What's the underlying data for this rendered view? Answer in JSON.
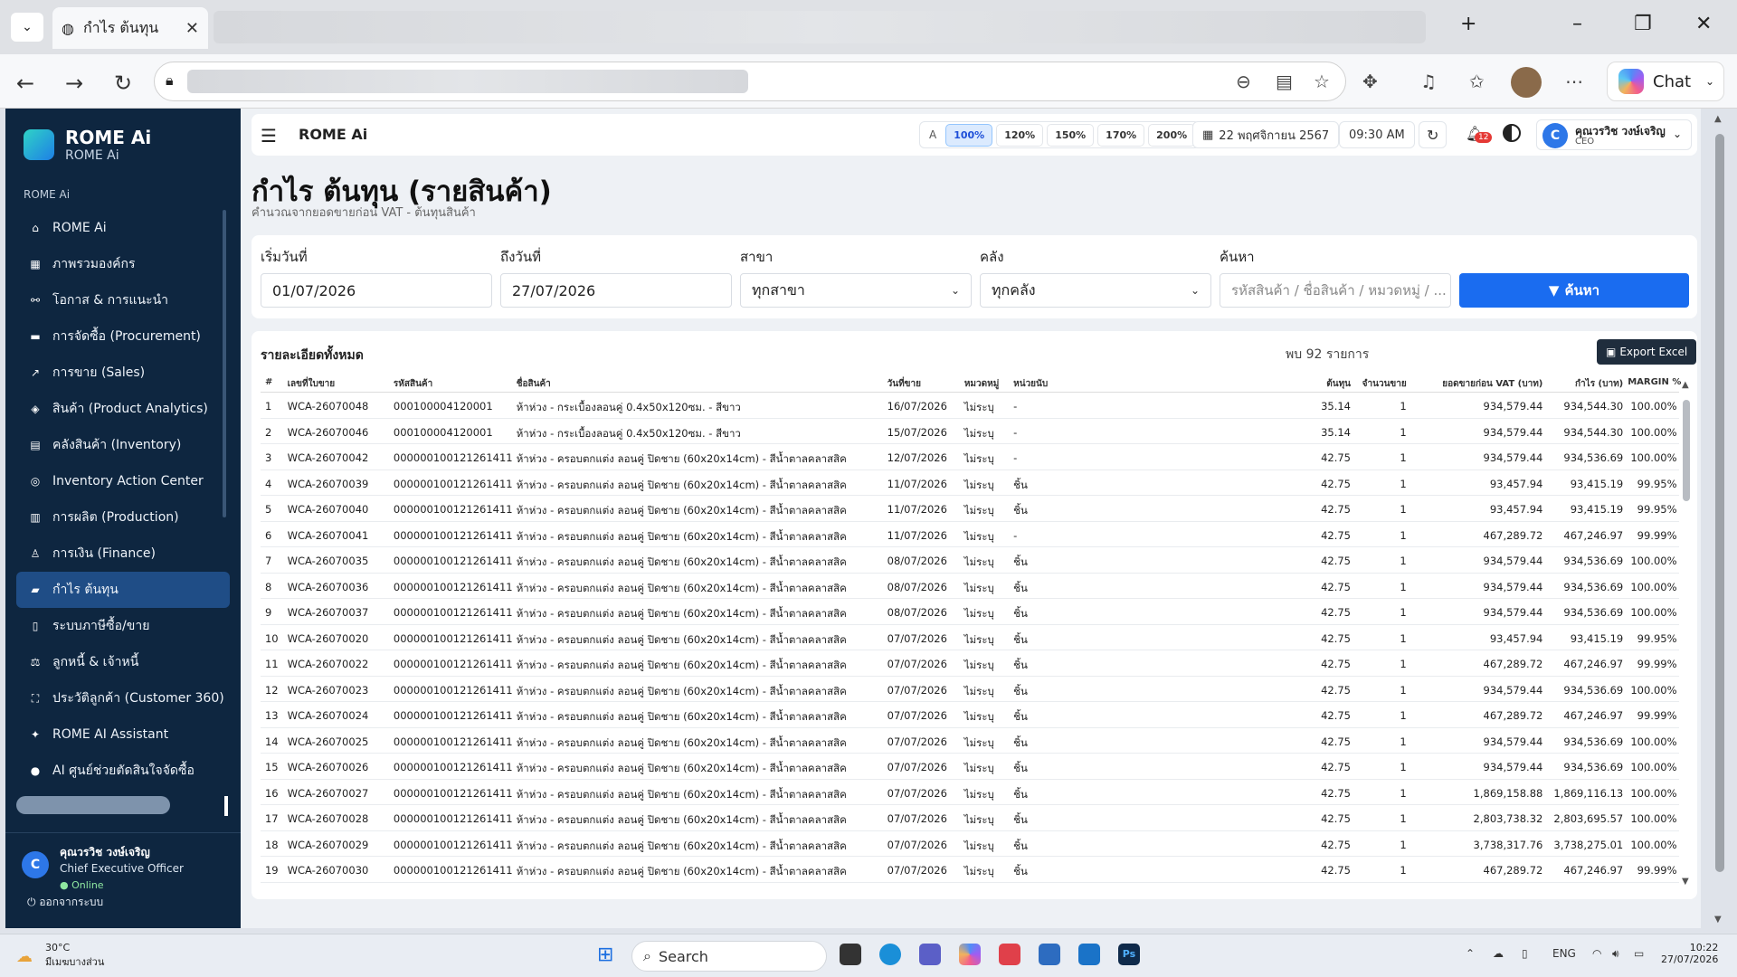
{
  "browser": {
    "tab_title": "กำไร ต้นทุน",
    "chat_label": "Chat"
  },
  "app": {
    "brand": "ROME Ai",
    "brand_sub": "ROME Ai",
    "section": "ROME Ai",
    "topbar_title": "ROME Ai"
  },
  "menu": [
    {
      "icon": "home-icon",
      "glyph": "⌂",
      "label": "ROME Ai"
    },
    {
      "icon": "building-icon",
      "glyph": "▦",
      "label": "ภาพรวมองค์กร"
    },
    {
      "icon": "link-icon",
      "glyph": "⚯",
      "label": "โอกาส & การแนะนำ"
    },
    {
      "icon": "cart-icon",
      "glyph": "▬",
      "label": "การจัดซื้อ (Procurement)"
    },
    {
      "icon": "chart-line-icon",
      "glyph": "↗",
      "label": "การขาย (Sales)"
    },
    {
      "icon": "boxes-icon",
      "glyph": "◈",
      "label": "สินค้า (Product Analytics)"
    },
    {
      "icon": "warehouse-icon",
      "glyph": "▤",
      "label": "คลังสินค้า (Inventory)"
    },
    {
      "icon": "target-icon",
      "glyph": "◎",
      "label": "Inventory Action Center"
    },
    {
      "icon": "factory-icon",
      "glyph": "▥",
      "label": "การผลิต (Production)"
    },
    {
      "icon": "money-icon",
      "glyph": "♙",
      "label": "การเงิน (Finance)"
    },
    {
      "icon": "profit-icon",
      "glyph": "▰",
      "label": "กำไร ต้นทุน",
      "active": true
    },
    {
      "icon": "receipt-icon",
      "glyph": "▯",
      "label": "ระบบภาษีซื้อ/ขาย"
    },
    {
      "icon": "scale-icon",
      "glyph": "⚖",
      "label": "ลูกหนี้ & เจ้าหนี้"
    },
    {
      "icon": "customer-icon",
      "glyph": "⛶",
      "label": "ประวัติลูกค้า (Customer 360)"
    },
    {
      "icon": "robot-icon",
      "glyph": "✦",
      "label": "ROME AI Assistant"
    },
    {
      "icon": "brain-icon",
      "glyph": "●",
      "label": "AI ศูนย์ช่วยตัดสินใจจัดซื้อ"
    }
  ],
  "user": {
    "initial": "C",
    "name": "คุณวรวิช วงษ์เจริญ",
    "role": "Chief Executive Officer",
    "status": "● Online",
    "logout": "ออกจากระบบ",
    "short_role": "CEO"
  },
  "zoom": {
    "a_label": "A",
    "levels": [
      "100%",
      "120%",
      "150%",
      "170%",
      "200%"
    ],
    "active": "100%"
  },
  "date_label": "22 พฤศจิกายน 2567",
  "time_label": "09:30 AM",
  "notif_count": "12",
  "page": {
    "title": "กำไร ต้นทุน (รายสินค้า)",
    "subtitle": "คำนวณจากยอดขายก่อน VAT - ต้นทุนสินค้า"
  },
  "filters": {
    "start_label": "เริ่มวันที่",
    "start_value": "01/07/2026",
    "end_label": "ถึงวันที่",
    "end_value": "27/07/2026",
    "branch_label": "สาขา",
    "branch_value": "ทุกสาขา",
    "wh_label": "คลัง",
    "wh_value": "ทุกคลัง",
    "search_label": "ค้นหา",
    "search_placeholder": "รหัสสินค้า / ชื่อสินค้า / หมวดหมู่ / ...",
    "search_button": "ค้นหา"
  },
  "table": {
    "title": "รายละเอียดทั้งหมด",
    "count": "พบ 92 รายการ",
    "export": "Export Excel",
    "headers": [
      "#",
      "เลขที่ใบขาย",
      "รหัสสินค้า",
      "ชื่อสินค้า",
      "วันที่ขาย",
      "หมวดหมู่",
      "หน่วยนับ",
      "ต้นทุน",
      "จำนวนขาย",
      "ยอดขายก่อน VAT (บาท)",
      "กำไร (บาท)",
      "MARGIN %"
    ],
    "rows": [
      [
        "1",
        "WCA-26070048",
        "000100004120001",
        "ห้าห่วง - กระเบื้องลอนคู่ 0.4x50x120ซม. - สีขาว",
        "16/07/2026",
        "ไม่ระบุ",
        "-",
        "35.14",
        "1",
        "934,579.44",
        "934,544.30",
        "100.00%"
      ],
      [
        "2",
        "WCA-26070046",
        "000100004120001",
        "ห้าห่วง - กระเบื้องลอนคู่ 0.4x50x120ซม. - สีขาว",
        "15/07/2026",
        "ไม่ระบุ",
        "-",
        "35.14",
        "1",
        "934,579.44",
        "934,544.30",
        "100.00%"
      ],
      [
        "3",
        "WCA-26070042",
        "000000100121261411",
        "ห้าห่วง - ครอบตกแต่ง ลอนคู่ ปิดชาย (60x20x14cm) - สีน้ำตาลคลาสสิค",
        "12/07/2026",
        "ไม่ระบุ",
        "-",
        "42.75",
        "1",
        "934,579.44",
        "934,536.69",
        "100.00%"
      ],
      [
        "4",
        "WCA-26070039",
        "000000100121261411",
        "ห้าห่วง - ครอบตกแต่ง ลอนคู่ ปิดชาย (60x20x14cm) - สีน้ำตาลคลาสสิค",
        "11/07/2026",
        "ไม่ระบุ",
        "ชิ้น",
        "42.75",
        "1",
        "93,457.94",
        "93,415.19",
        "99.95%"
      ],
      [
        "5",
        "WCA-26070040",
        "000000100121261411",
        "ห้าห่วง - ครอบตกแต่ง ลอนคู่ ปิดชาย (60x20x14cm) - สีน้ำตาลคลาสสิค",
        "11/07/2026",
        "ไม่ระบุ",
        "ชิ้น",
        "42.75",
        "1",
        "93,457.94",
        "93,415.19",
        "99.95%"
      ],
      [
        "6",
        "WCA-26070041",
        "000000100121261411",
        "ห้าห่วง - ครอบตกแต่ง ลอนคู่ ปิดชาย (60x20x14cm) - สีน้ำตาลคลาสสิค",
        "11/07/2026",
        "ไม่ระบุ",
        "-",
        "42.75",
        "1",
        "467,289.72",
        "467,246.97",
        "99.99%"
      ],
      [
        "7",
        "WCA-26070035",
        "000000100121261411",
        "ห้าห่วง - ครอบตกแต่ง ลอนคู่ ปิดชาย (60x20x14cm) - สีน้ำตาลคลาสสิค",
        "08/07/2026",
        "ไม่ระบุ",
        "ชิ้น",
        "42.75",
        "1",
        "934,579.44",
        "934,536.69",
        "100.00%"
      ],
      [
        "8",
        "WCA-26070036",
        "000000100121261411",
        "ห้าห่วง - ครอบตกแต่ง ลอนคู่ ปิดชาย (60x20x14cm) - สีน้ำตาลคลาสสิค",
        "08/07/2026",
        "ไม่ระบุ",
        "ชิ้น",
        "42.75",
        "1",
        "934,579.44",
        "934,536.69",
        "100.00%"
      ],
      [
        "9",
        "WCA-26070037",
        "000000100121261411",
        "ห้าห่วง - ครอบตกแต่ง ลอนคู่ ปิดชาย (60x20x14cm) - สีน้ำตาลคลาสสิค",
        "08/07/2026",
        "ไม่ระบุ",
        "ชิ้น",
        "42.75",
        "1",
        "934,579.44",
        "934,536.69",
        "100.00%"
      ],
      [
        "10",
        "WCA-26070020",
        "000000100121261411",
        "ห้าห่วง - ครอบตกแต่ง ลอนคู่ ปิดชาย (60x20x14cm) - สีน้ำตาลคลาสสิค",
        "07/07/2026",
        "ไม่ระบุ",
        "ชิ้น",
        "42.75",
        "1",
        "93,457.94",
        "93,415.19",
        "99.95%"
      ],
      [
        "11",
        "WCA-26070022",
        "000000100121261411",
        "ห้าห่วง - ครอบตกแต่ง ลอนคู่ ปิดชาย (60x20x14cm) - สีน้ำตาลคลาสสิค",
        "07/07/2026",
        "ไม่ระบุ",
        "ชิ้น",
        "42.75",
        "1",
        "467,289.72",
        "467,246.97",
        "99.99%"
      ],
      [
        "12",
        "WCA-26070023",
        "000000100121261411",
        "ห้าห่วง - ครอบตกแต่ง ลอนคู่ ปิดชาย (60x20x14cm) - สีน้ำตาลคลาสสิค",
        "07/07/2026",
        "ไม่ระบุ",
        "ชิ้น",
        "42.75",
        "1",
        "934,579.44",
        "934,536.69",
        "100.00%"
      ],
      [
        "13",
        "WCA-26070024",
        "000000100121261411",
        "ห้าห่วง - ครอบตกแต่ง ลอนคู่ ปิดชาย (60x20x14cm) - สีน้ำตาลคลาสสิค",
        "07/07/2026",
        "ไม่ระบุ",
        "ชิ้น",
        "42.75",
        "1",
        "467,289.72",
        "467,246.97",
        "99.99%"
      ],
      [
        "14",
        "WCA-26070025",
        "000000100121261411",
        "ห้าห่วง - ครอบตกแต่ง ลอนคู่ ปิดชาย (60x20x14cm) - สีน้ำตาลคลาสสิค",
        "07/07/2026",
        "ไม่ระบุ",
        "ชิ้น",
        "42.75",
        "1",
        "934,579.44",
        "934,536.69",
        "100.00%"
      ],
      [
        "15",
        "WCA-26070026",
        "000000100121261411",
        "ห้าห่วง - ครอบตกแต่ง ลอนคู่ ปิดชาย (60x20x14cm) - สีน้ำตาลคลาสสิค",
        "07/07/2026",
        "ไม่ระบุ",
        "ชิ้น",
        "42.75",
        "1",
        "934,579.44",
        "934,536.69",
        "100.00%"
      ],
      [
        "16",
        "WCA-26070027",
        "000000100121261411",
        "ห้าห่วง - ครอบตกแต่ง ลอนคู่ ปิดชาย (60x20x14cm) - สีน้ำตาลคลาสสิค",
        "07/07/2026",
        "ไม่ระบุ",
        "ชิ้น",
        "42.75",
        "1",
        "1,869,158.88",
        "1,869,116.13",
        "100.00%"
      ],
      [
        "17",
        "WCA-26070028",
        "000000100121261411",
        "ห้าห่วง - ครอบตกแต่ง ลอนคู่ ปิดชาย (60x20x14cm) - สีน้ำตาลคลาสสิค",
        "07/07/2026",
        "ไม่ระบุ",
        "ชิ้น",
        "42.75",
        "1",
        "2,803,738.32",
        "2,803,695.57",
        "100.00%"
      ],
      [
        "18",
        "WCA-26070029",
        "000000100121261411",
        "ห้าห่วง - ครอบตกแต่ง ลอนคู่ ปิดชาย (60x20x14cm) - สีน้ำตาลคลาสสิค",
        "07/07/2026",
        "ไม่ระบุ",
        "ชิ้น",
        "42.75",
        "1",
        "3,738,317.76",
        "3,738,275.01",
        "100.00%"
      ],
      [
        "19",
        "WCA-26070030",
        "000000100121261411",
        "ห้าห่วง - ครอบตกแต่ง ลอนคู่ ปิดชาย (60x20x14cm) - สีน้ำตาลคลาสสิค",
        "07/07/2026",
        "ไม่ระบุ",
        "ชิ้น",
        "42.75",
        "1",
        "467,289.72",
        "467,246.97",
        "99.99%"
      ]
    ]
  },
  "taskbar": {
    "temp": "30°C",
    "weather": "มีเมฆบางส่วน",
    "search": "Search",
    "lang": "ENG",
    "time": "10:22",
    "date": "27/07/2026"
  }
}
